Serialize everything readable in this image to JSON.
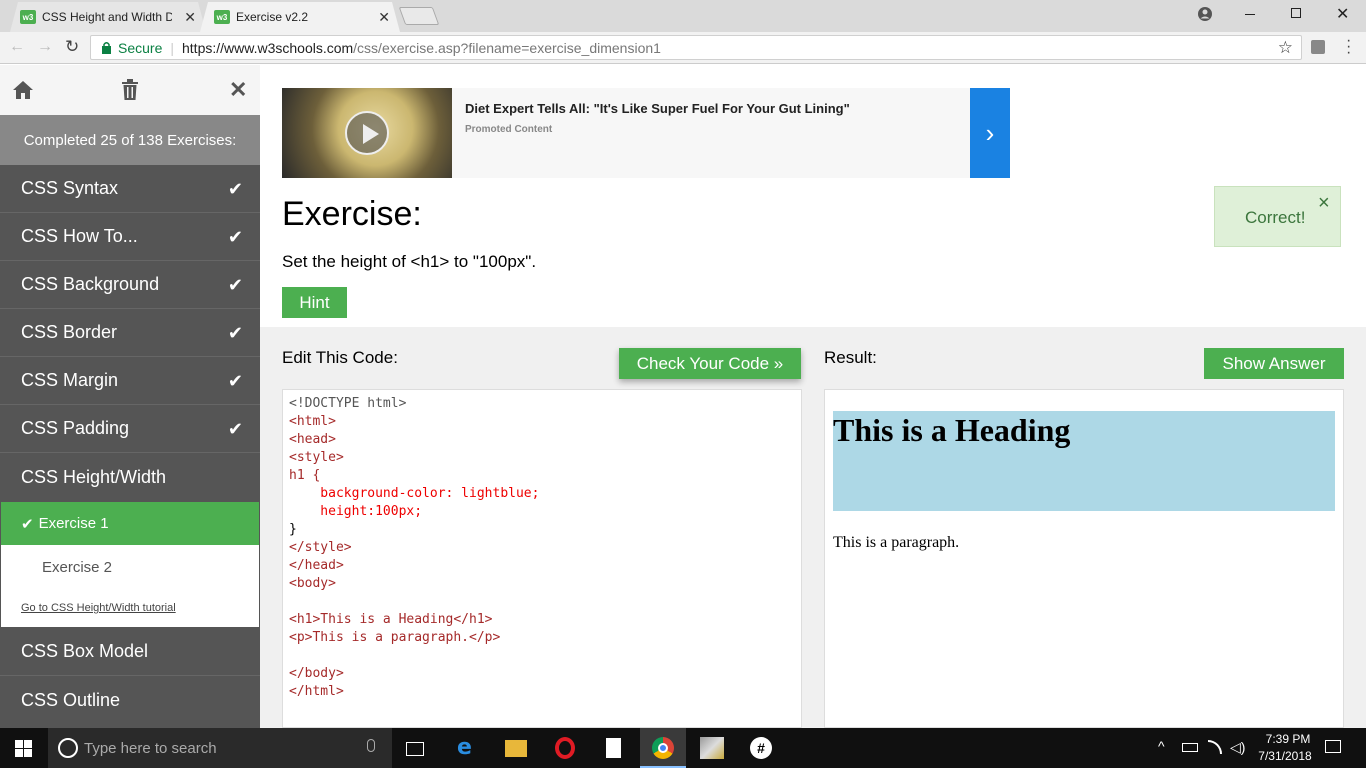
{
  "browser": {
    "tabs": [
      {
        "title": "CSS Height and Width Di",
        "favicon": "w3"
      },
      {
        "title": "Exercise v2.2",
        "favicon": "w3"
      }
    ],
    "secure_label": "Secure",
    "url_host": "https://www.w3schools.com",
    "url_path": "/css/exercise.asp?filename=exercise_dimension1"
  },
  "sidebar": {
    "status": "Completed 25 of 138 Exercises:",
    "items": [
      {
        "label": "CSS Syntax",
        "done": true
      },
      {
        "label": "CSS How To...",
        "done": true
      },
      {
        "label": "CSS Background",
        "done": true
      },
      {
        "label": "CSS Border",
        "done": true
      },
      {
        "label": "CSS Margin",
        "done": true
      },
      {
        "label": "CSS Padding",
        "done": true
      },
      {
        "label": "CSS Height/Width",
        "done": false
      }
    ],
    "sub_items": [
      "Exercise 1",
      "Exercise 2"
    ],
    "tutorial_link": "Go to CSS Height/Width tutorial",
    "after_items": [
      "CSS Box Model",
      "CSS Outline"
    ]
  },
  "ad": {
    "headline": "Diet Expert Tells All: \"It's Like Super Fuel For Your Gut Lining\"",
    "sub": "Promoted Content"
  },
  "exercise": {
    "title": "Exercise:",
    "instruction": "Set the height of <h1> to \"100px\".",
    "hint_label": "Hint",
    "correct_label": "Correct!",
    "close_glyph": "×"
  },
  "editor": {
    "label": "Edit This Code:",
    "check_button": "Check Your Code »",
    "lines": [
      "<!DOCTYPE html>",
      "<html>",
      "<head>",
      "<style>",
      "h1 {",
      "    background-color: lightblue;",
      "    height:100px;",
      "}",
      "</style>",
      "</head>",
      "<body>",
      "",
      "<h1>This is a Heading</h1>",
      "<p>This is a paragraph.</p>",
      "",
      "</body>",
      "</html>"
    ]
  },
  "result": {
    "label": "Result:",
    "show_answer": "Show Answer",
    "heading": "This is a Heading",
    "paragraph": "This is a paragraph.",
    "heading_bg": "#add8e6"
  },
  "taskbar": {
    "search_placeholder": "Type here to search",
    "time": "7:39 PM",
    "date": "7/31/2018"
  },
  "colors": {
    "accent": "#4caf50",
    "sidebar": "#555555",
    "ad_arrow": "#1a82e2"
  }
}
